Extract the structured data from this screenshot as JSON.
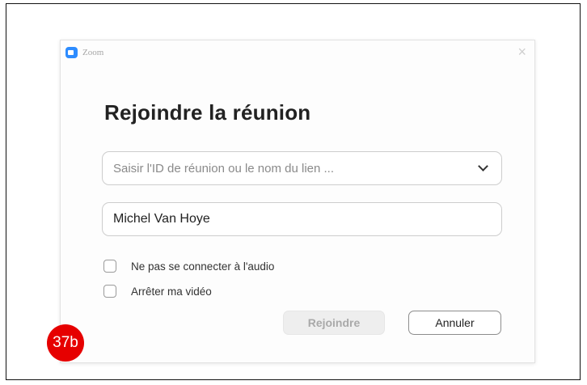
{
  "window": {
    "app_title": "Zoom",
    "close_glyph": "×",
    "logo_icon": "zoom-camera-icon",
    "accent_color": "#2d8cff"
  },
  "dialog": {
    "heading": "Rejoindre la réunion",
    "meeting_field": {
      "value": "",
      "placeholder": "Saisir l'ID de réunion ou le nom du lien ...",
      "dropdown_icon": "chevron-down-icon"
    },
    "name_field": {
      "value": "Michel Van Hoye",
      "placeholder": ""
    },
    "options": [
      {
        "label": "Ne pas se connecter à l'audio",
        "checked": false
      },
      {
        "label": "Arrêter ma vidéo",
        "checked": false
      }
    ],
    "buttons": {
      "join_label": "Rejoindre",
      "join_disabled": true,
      "cancel_label": "Annuler"
    }
  },
  "annotation": {
    "badge_label": "37b",
    "badge_color": "#e60000"
  }
}
